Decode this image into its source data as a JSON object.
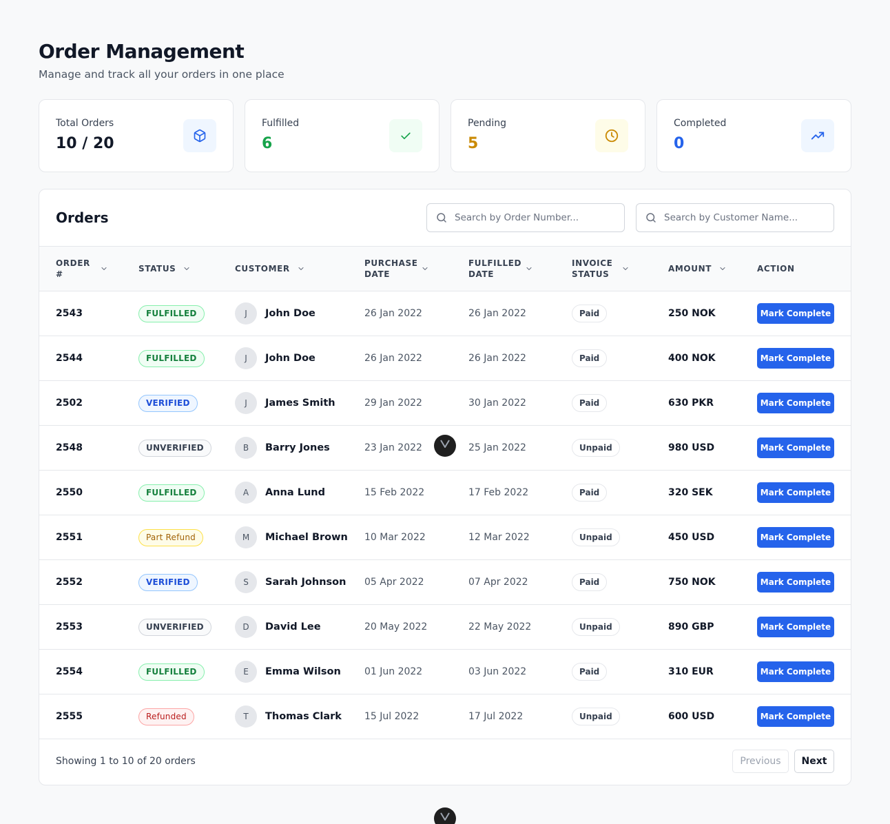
{
  "header": {
    "title": "Order Management",
    "subtitle": "Manage and track all your orders in one place"
  },
  "stats": [
    {
      "label": "Total Orders",
      "value": "10 / 20",
      "value_color": "#111827",
      "icon": "box-icon",
      "icon_bg": "#eff6ff",
      "icon_color": "#2563eb"
    },
    {
      "label": "Fulfilled",
      "value": "6",
      "value_color": "#16a34a",
      "icon": "check-icon",
      "icon_bg": "#f0fdf4",
      "icon_color": "#16a34a"
    },
    {
      "label": "Pending",
      "value": "5",
      "value_color": "#ca8a04",
      "icon": "clock-icon",
      "icon_bg": "#fefce8",
      "icon_color": "#ca8a04"
    },
    {
      "label": "Completed",
      "value": "0",
      "value_color": "#2563eb",
      "icon": "trending-up-icon",
      "icon_bg": "#eff6ff",
      "icon_color": "#2563eb"
    }
  ],
  "orders": {
    "title": "Orders",
    "search_order_placeholder": "Search by Order Number...",
    "search_customer_placeholder": "Search by Customer Name...",
    "columns": [
      {
        "label": "Order #",
        "sortable": true
      },
      {
        "label": "Status",
        "sortable": true
      },
      {
        "label": "Customer",
        "sortable": true
      },
      {
        "label": "Purchase Date",
        "sortable": true
      },
      {
        "label": "Fulfilled Date",
        "sortable": true
      },
      {
        "label": "Invoice Status",
        "sortable": true
      },
      {
        "label": "Amount",
        "sortable": true
      },
      {
        "label": "Action",
        "sortable": false
      }
    ],
    "rows": [
      {
        "order": "2543",
        "status": "FULFILLED",
        "status_type": "fulfilled",
        "initial": "J",
        "customer": "John Doe",
        "purchase_date": "26 Jan 2022",
        "fulfilled_date": "26 Jan 2022",
        "invoice": "Paid",
        "amount": "250 NOK",
        "action": "Mark Complete"
      },
      {
        "order": "2544",
        "status": "FULFILLED",
        "status_type": "fulfilled",
        "initial": "J",
        "customer": "John Doe",
        "purchase_date": "26 Jan 2022",
        "fulfilled_date": "26 Jan 2022",
        "invoice": "Paid",
        "amount": "400 NOK",
        "action": "Mark Complete"
      },
      {
        "order": "2502",
        "status": "VERIFIED",
        "status_type": "verified",
        "initial": "J",
        "customer": "James Smith",
        "purchase_date": "29 Jan 2022",
        "fulfilled_date": "30 Jan 2022",
        "invoice": "Paid",
        "amount": "630 PKR",
        "action": "Mark Complete"
      },
      {
        "order": "2548",
        "status": "UNVERIFIED",
        "status_type": "unverified",
        "initial": "B",
        "customer": "Barry Jones",
        "purchase_date": "23 Jan 2022",
        "fulfilled_date": "25 Jan 2022",
        "invoice": "Unpaid",
        "amount": "980 USD",
        "action": "Mark Complete"
      },
      {
        "order": "2550",
        "status": "FULFILLED",
        "status_type": "fulfilled",
        "initial": "A",
        "customer": "Anna Lund",
        "purchase_date": "15 Feb 2022",
        "fulfilled_date": "17 Feb 2022",
        "invoice": "Paid",
        "amount": "320 SEK",
        "action": "Mark Complete"
      },
      {
        "order": "2551",
        "status": "Part Refund",
        "status_type": "partrefund",
        "initial": "M",
        "customer": "Michael Brown",
        "purchase_date": "10 Mar 2022",
        "fulfilled_date": "12 Mar 2022",
        "invoice": "Unpaid",
        "amount": "450 USD",
        "action": "Mark Complete"
      },
      {
        "order": "2552",
        "status": "VERIFIED",
        "status_type": "verified",
        "initial": "S",
        "customer": "Sarah Johnson",
        "purchase_date": "05 Apr 2022",
        "fulfilled_date": "07 Apr 2022",
        "invoice": "Paid",
        "amount": "750 NOK",
        "action": "Mark Complete"
      },
      {
        "order": "2553",
        "status": "UNVERIFIED",
        "status_type": "unverified",
        "initial": "D",
        "customer": "David Lee",
        "purchase_date": "20 May 2022",
        "fulfilled_date": "22 May 2022",
        "invoice": "Unpaid",
        "amount": "890 GBP",
        "action": "Mark Complete"
      },
      {
        "order": "2554",
        "status": "FULFILLED",
        "status_type": "fulfilled",
        "initial": "E",
        "customer": "Emma Wilson",
        "purchase_date": "01 Jun 2022",
        "fulfilled_date": "03 Jun 2022",
        "invoice": "Paid",
        "amount": "310 EUR",
        "action": "Mark Complete"
      },
      {
        "order": "2555",
        "status": "Refunded",
        "status_type": "refunded",
        "initial": "T",
        "customer": "Thomas Clark",
        "purchase_date": "15 Jul 2022",
        "fulfilled_date": "17 Jul 2022",
        "invoice": "Unpaid",
        "amount": "600 USD",
        "action": "Mark Complete"
      }
    ],
    "footer": {
      "showing": "Showing 1 to 10 of 20 orders",
      "previous": "Previous",
      "next": "Next"
    }
  },
  "accent_color": "#2563eb"
}
